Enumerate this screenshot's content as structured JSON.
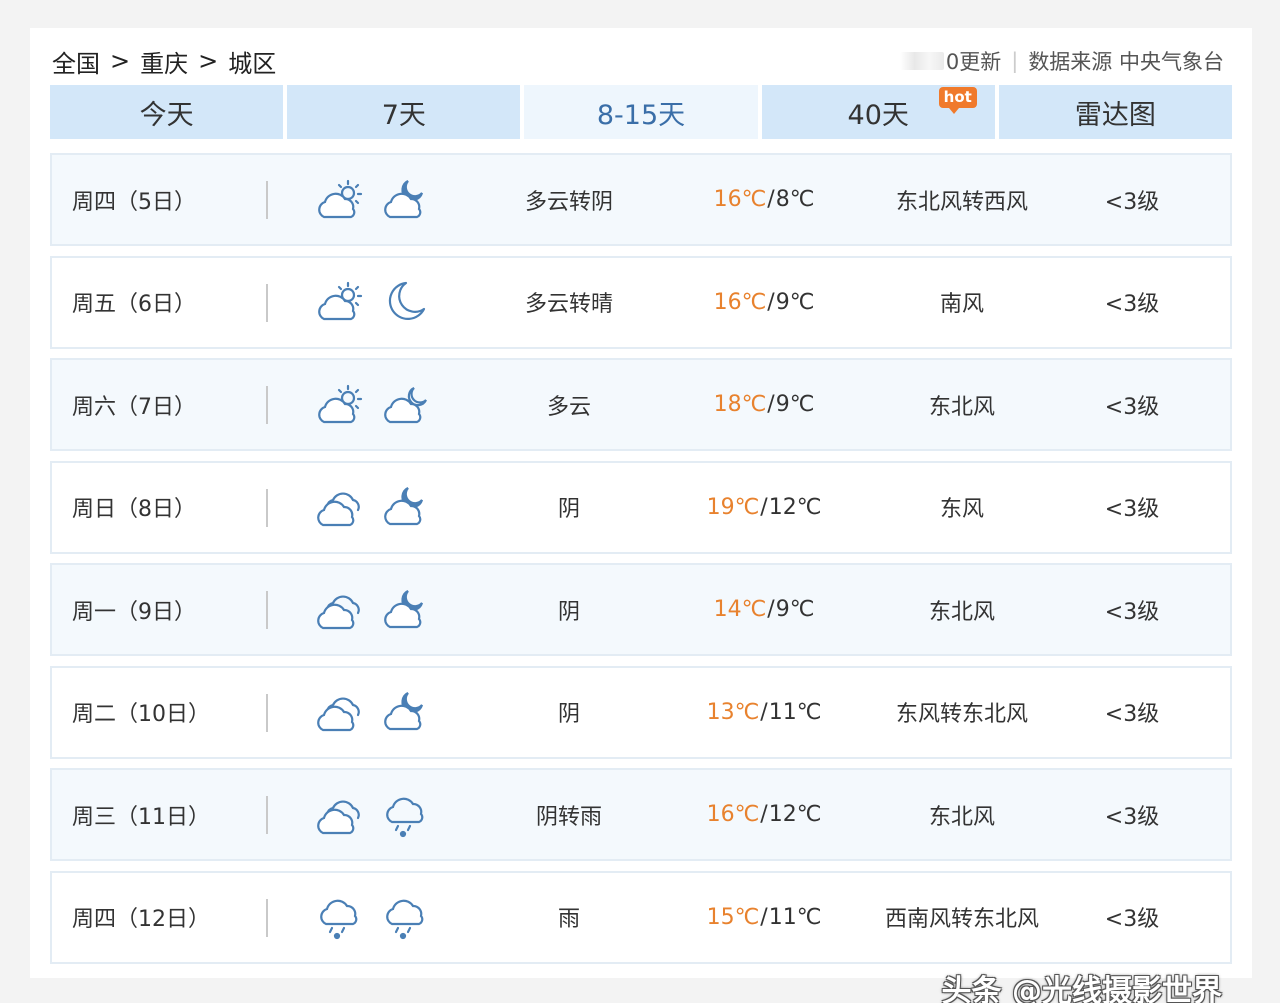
{
  "breadcrumb": {
    "items": [
      "全国",
      "重庆",
      "城区"
    ],
    "separator": ">"
  },
  "source": {
    "update": "0更新",
    "divider": "|",
    "label": "数据来源 中央气象台"
  },
  "tabs": [
    {
      "label": "今天",
      "active": false
    },
    {
      "label": "7天",
      "active": false
    },
    {
      "label": "8-15天",
      "active": true
    },
    {
      "label": "40天",
      "active": false,
      "badge": "hot"
    },
    {
      "label": "雷达图",
      "active": false
    }
  ],
  "forecast": [
    {
      "date": "周四（5日）",
      "day_icon": "partly-cloudy-day-icon",
      "night_icon": "cloudy-night-icon",
      "desc": "多云转阴",
      "high": "16℃",
      "low": "8℃",
      "wind": "东北风转西风",
      "level": "<3级"
    },
    {
      "date": "周五（6日）",
      "day_icon": "partly-cloudy-day-icon",
      "night_icon": "clear-night-icon",
      "desc": "多云转晴",
      "high": "16℃",
      "low": "9℃",
      "wind": "南风",
      "level": "<3级"
    },
    {
      "date": "周六（7日）",
      "day_icon": "partly-cloudy-day-icon",
      "night_icon": "partly-cloudy-night-icon",
      "desc": "多云",
      "high": "18℃",
      "low": "9℃",
      "wind": "东北风",
      "level": "<3级"
    },
    {
      "date": "周日（8日）",
      "day_icon": "overcast-icon",
      "night_icon": "cloudy-night-icon",
      "desc": "阴",
      "high": "19℃",
      "low": "12℃",
      "wind": "东风",
      "level": "<3级"
    },
    {
      "date": "周一（9日）",
      "day_icon": "overcast-icon",
      "night_icon": "cloudy-night-icon",
      "desc": "阴",
      "high": "14℃",
      "low": "9℃",
      "wind": "东北风",
      "level": "<3级"
    },
    {
      "date": "周二（10日）",
      "day_icon": "overcast-icon",
      "night_icon": "cloudy-night-icon",
      "desc": "阴",
      "high": "13℃",
      "low": "11℃",
      "wind": "东风转东北风",
      "level": "<3级"
    },
    {
      "date": "周三（11日）",
      "day_icon": "overcast-icon",
      "night_icon": "rain-icon",
      "desc": "阴转雨",
      "high": "16℃",
      "low": "12℃",
      "wind": "东北风",
      "level": "<3级"
    },
    {
      "date": "周四（12日）",
      "day_icon": "rain-icon",
      "night_icon": "rain-icon",
      "desc": "雨",
      "high": "15℃",
      "low": "11℃",
      "wind": "西南风转东北风",
      "level": "<3级"
    }
  ],
  "watermark": "头条 @光线摄影世界",
  "colors": {
    "tab_bg": "#d3e7f9",
    "tab_active_bg": "#eef6fd",
    "tab_active_text": "#3a6ea8",
    "high_temp": "#e8822e",
    "icon_stroke": "#4a7fb5",
    "hot_badge": "#f07a2c"
  }
}
